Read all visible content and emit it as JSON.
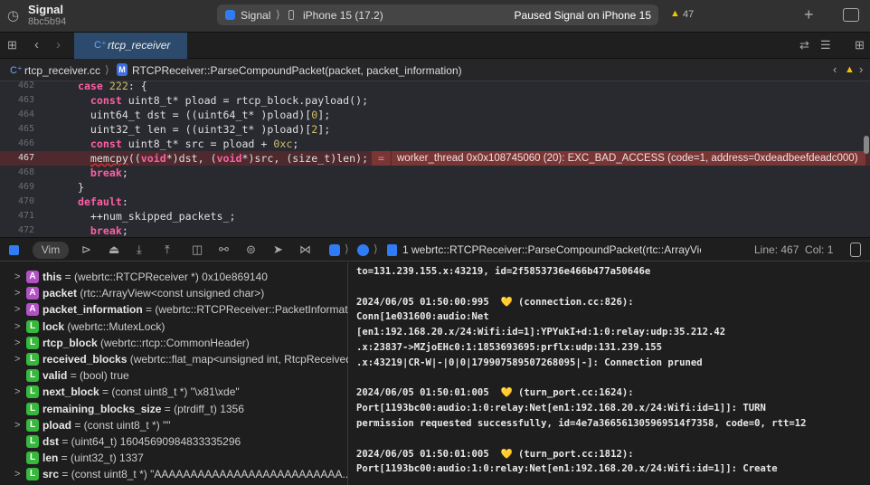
{
  "toolbar": {
    "project": "Signal",
    "commit": "8bc5b94",
    "scheme": "Signal",
    "device": "iPhone 15 (17.2)",
    "status": "Paused Signal on iPhone 15",
    "warnings": "47"
  },
  "tabbar": {
    "tab": "rtcp_receiver"
  },
  "jumpbar": {
    "file": "rtcp_receiver.cc",
    "method": "RTCPReceiver::ParseCompoundPacket(packet, packet_information)"
  },
  "editor": {
    "lines": [
      {
        "n": "462",
        "html": "<span class='kw'>case</span> <span class='num'>222</span>: {",
        "indent": "  "
      },
      {
        "n": "463",
        "html": "<span class='kw'>const</span> uint8_t* pload = rtcp_block.payload();",
        "indent": "    "
      },
      {
        "n": "464",
        "html": "uint64_t dst = ((uint64_t* )pload)[<span class='num'>0</span>];",
        "indent": "    "
      },
      {
        "n": "465",
        "html": "uint32_t len = ((uint32_t* )pload)[<span class='num'>2</span>];",
        "indent": "    "
      },
      {
        "n": "466",
        "html": "<span class='kw'>const</span> uint8_t* src = pload + <span class='num'>0xc</span>;",
        "indent": "    "
      },
      {
        "n": "467",
        "html": "<span style='text-decoration:underline wavy #e33'>memcpy</span>((<span class='kw'>void</span>*)dst, (<span class='kw'>void</span>*)src, (size_t)len);",
        "indent": "    "
      },
      {
        "n": "468",
        "html": "<span class='kw'>break</span>;",
        "indent": "    "
      },
      {
        "n": "469",
        "html": "}",
        "indent": "  "
      },
      {
        "n": "470",
        "html": "<span class='kw'>default</span>:",
        "indent": "  "
      },
      {
        "n": "471",
        "html": "++num_skipped_packets_;",
        "indent": "    "
      },
      {
        "n": "472",
        "html": "<span class='kw'>break</span>;",
        "indent": "    "
      }
    ],
    "error": "worker_thread 0x0x108745060 (20): EXC_BAD_ACCESS (code=1, address=0xdeadbeefdeadc000)"
  },
  "debugbar": {
    "vim": "Vim",
    "frame": "1 webrtc::RTCPReceiver::ParseCompoundPacket(rtc::ArrayView<unsig",
    "position": "Line: 467  Col: 1"
  },
  "variables": [
    {
      "kind": "A",
      "expand": true,
      "name": "this",
      "rest": " = (webrtc::RTCPReceiver *) 0x10e869140"
    },
    {
      "kind": "A",
      "expand": true,
      "name": "packet",
      "rest": " (rtc::ArrayView<const unsigned char>)"
    },
    {
      "kind": "A",
      "expand": true,
      "name": "packet_information",
      "rest": " = (webrtc::RTCPReceiver::PacketInformatio..."
    },
    {
      "kind": "L",
      "expand": true,
      "name": "lock",
      "rest": " (webrtc::MutexLock)"
    },
    {
      "kind": "L",
      "expand": true,
      "name": "rtcp_block",
      "rest": " (webrtc::rtcp::CommonHeader)"
    },
    {
      "kind": "L",
      "expand": true,
      "name": "received_blocks",
      "rest": " (webrtc::flat_map<unsigned int, RtcpReceived..."
    },
    {
      "kind": "L",
      "expand": false,
      "name": "valid",
      "rest": " = (bool) true"
    },
    {
      "kind": "L",
      "expand": true,
      "name": "next_block",
      "rest": " = (const uint8_t *) \"\\x81\\xde\""
    },
    {
      "kind": "L",
      "expand": false,
      "name": "remaining_blocks_size",
      "rest": " = (ptrdiff_t) 1356"
    },
    {
      "kind": "L",
      "expand": true,
      "name": "pload",
      "rest": " = (const uint8_t *) \"\""
    },
    {
      "kind": "L",
      "expand": false,
      "name": "dst",
      "rest": " = (uint64_t) 16045690984833335296"
    },
    {
      "kind": "L",
      "expand": false,
      "name": "len",
      "rest": " = (uint32_t) 1337"
    },
    {
      "kind": "L",
      "expand": true,
      "name": "src",
      "rest": " = (const uint8_t *) \"AAAAAAAAAAAAAAAAAAAAAAAAAA..."
    }
  ],
  "console": [
    "to=131.239.155.x:43219, id=2f5853736e466b477a50646e",
    "",
    "2024/06/05 01:50:00:995  💛 (connection.cc:826):",
    "Conn[1e031600:audio:Net",
    "[en1:192.168.20.x/24:Wifi:id=1]:YPYukI+d:1:0:relay:udp:35.212.42",
    ".x:23837->MZjoEHc0:1:1853693695:prflx:udp:131.239.155",
    ".x:43219|CR-W|-|0|0|179907589507268095|-]: Connection pruned",
    "",
    "2024/06/05 01:50:01:005  💛 (turn_port.cc:1624):",
    "Port[1193bc00:audio:1:0:relay:Net[en1:192.168.20.x/24:Wifi:id=1]]: TURN",
    "permission requested successfully, id=4e7a366561305969514f7358, code=0, rtt=12",
    "",
    "2024/06/05 01:50:01:005  💛 (turn_port.cc:1812):",
    "Port[1193bc00:audio:1:0:relay:Net[en1:192.168.20.x/24:Wifi:id=1]]: Create"
  ]
}
